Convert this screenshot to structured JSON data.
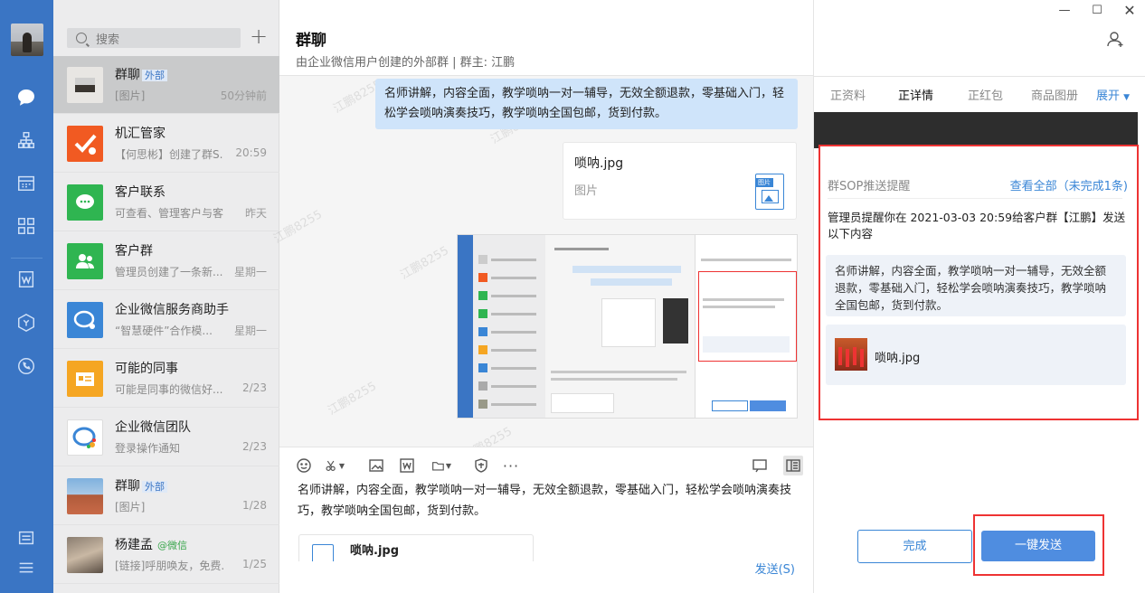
{
  "search": {
    "placeholder": "搜索"
  },
  "conversations": [
    {
      "name": "群聊",
      "tag": "外部",
      "msg": "[图片]",
      "time": "50分钟前"
    },
    {
      "name": "机汇管家",
      "tag": "",
      "msg": "【何思彬】创建了群S...",
      "time": "20:59"
    },
    {
      "name": "客户联系",
      "tag": "",
      "msg": "可查看、管理客户与客...",
      "time": "昨天"
    },
    {
      "name": "客户群",
      "tag": "",
      "msg": "管理员创建了一条新...",
      "time": "星期一"
    },
    {
      "name": "企业微信服务商助手",
      "tag": "",
      "msg": "“智慧硬件”合作模...",
      "time": "星期一"
    },
    {
      "name": "可能的同事",
      "tag": "",
      "msg": "可能是同事的微信好...",
      "time": "2/23"
    },
    {
      "name": "企业微信团队",
      "tag": "",
      "msg": "登录操作通知",
      "time": "2/23"
    },
    {
      "name": "群聊",
      "tag": "外部",
      "msg": "[图片]",
      "time": "1/28"
    },
    {
      "name": "杨建孟",
      "tag": "@微信",
      "msg": "[链接]呼朋唤友，免费...",
      "time": "1/25"
    }
  ],
  "chat": {
    "title": "群聊",
    "subtitle": "由企业微信用户创建的外部群 | 群主: 江鹏",
    "message_text": "名师讲解，内容全面，教学唢呐一对一辅导，无效全额退款，零基础入门，轻松学会唢呐演奏技巧，教学唢呐全国包邮，货到付款。",
    "file_name": "唢呐.jpg",
    "file_type": "图片",
    "file_icon_label": "图片",
    "watermark": "江鹏8255",
    "draft_text": "名师讲解，内容全面，教学唢呐一对一辅导，无效全额退款，零基础入门，轻松学会唢呐演奏技巧，教学唢呐全国包邮，货到付款。",
    "draft_file": "唢呐.jpg",
    "send_label": "发送(S)"
  },
  "right": {
    "tabs": [
      "正资料",
      "正详情",
      "正红包",
      "商品图册"
    ],
    "expand_label": "展开",
    "sop_title": "群SOP推送提醒",
    "sop_view_all": "查看全部（未完成1条)",
    "sop_desc": "管理员提醒你在 2021-03-03 20:59给客户群【江鹏】发送以下内容",
    "sop_quote": "名师讲解，内容全面，教学唢呐一对一辅导，无效全额退款，零基础入门，轻松学会唢呐演奏技巧，教学唢呐全国包邮，货到付款。",
    "sop_file": "唢呐.jpg",
    "done_label": "完成",
    "send_all_label": "一键发送"
  },
  "colors": {
    "rail": "#3a75c4",
    "accent": "#3a86d6",
    "highlight": "#e33333"
  }
}
